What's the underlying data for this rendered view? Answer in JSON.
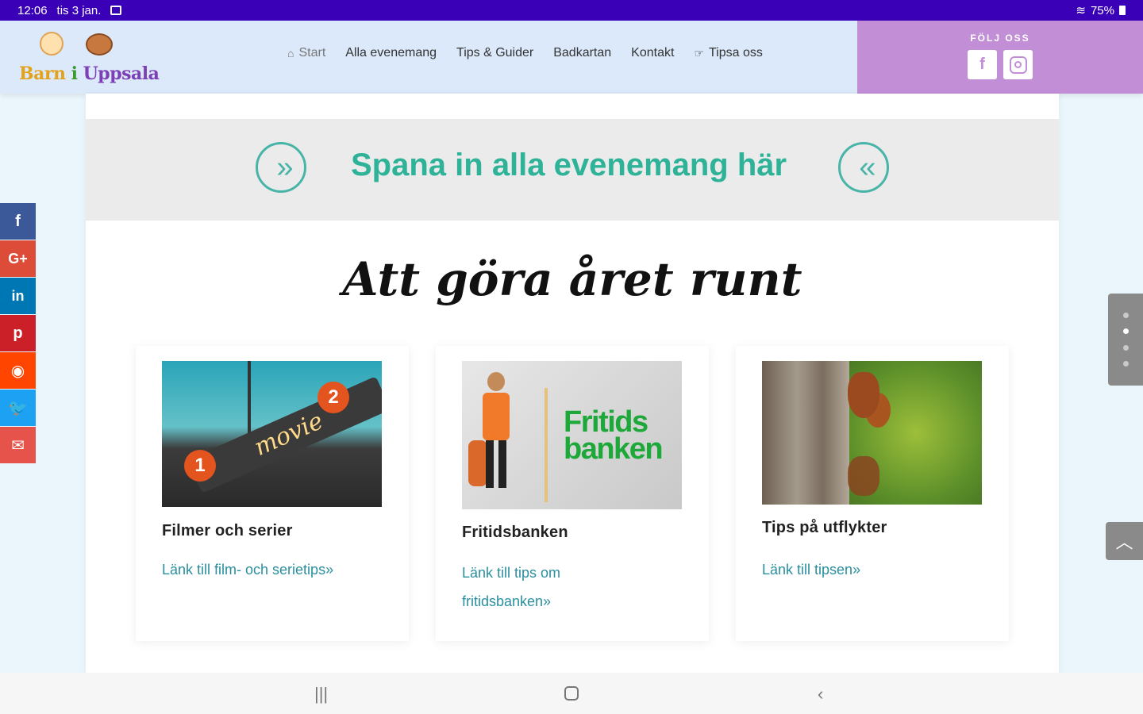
{
  "status_bar": {
    "time": "12:06",
    "date": "tis 3 jan.",
    "battery": "75%"
  },
  "header": {
    "logo_text": [
      "Barn",
      " i ",
      "Uppsala"
    ],
    "nav": [
      {
        "label": "Start",
        "icon": "home-icon"
      },
      {
        "label": "Alla evenemang"
      },
      {
        "label": "Tips & Guider"
      },
      {
        "label": "Badkartan"
      },
      {
        "label": "Kontakt"
      },
      {
        "label": "Tipsa oss",
        "icon": "pointing-hand-icon"
      }
    ],
    "follow": {
      "title": "FÖLJ OSS",
      "facebook_glyph": "f"
    }
  },
  "banner": {
    "text": "Spana in alla evenemang här"
  },
  "section": {
    "heading": "Att göra året runt"
  },
  "cards": [
    {
      "title": "Filmer och serier",
      "link": "Länk till film- och serietips»",
      "image_sign": "movie",
      "image_num1": "1",
      "image_num2": "2"
    },
    {
      "title": "Fritidsbanken",
      "link": "Länk till tips om fritidsbanken»",
      "image_logo_line1": "Fritids",
      "image_logo_line2": "banken"
    },
    {
      "title": "Tips på utflykter",
      "link": "Länk till tipsen»"
    }
  ],
  "social_bar": [
    {
      "name": "facebook",
      "glyph": "f"
    },
    {
      "name": "google-plus",
      "glyph": "G+"
    },
    {
      "name": "linkedin",
      "glyph": "in"
    },
    {
      "name": "pinterest",
      "glyph": "p"
    },
    {
      "name": "reddit",
      "glyph": "◉"
    },
    {
      "name": "twitter",
      "glyph": "🐦"
    },
    {
      "name": "email",
      "glyph": "✉"
    }
  ],
  "dot_nav": {
    "count": 4,
    "active_index": 1
  },
  "colors": {
    "status_bar": "#3a00b8",
    "header_bg": "#dbe9fb",
    "follow_bg": "#c28fd7",
    "accent_teal": "#2eb399",
    "link": "#2a8f9f"
  }
}
